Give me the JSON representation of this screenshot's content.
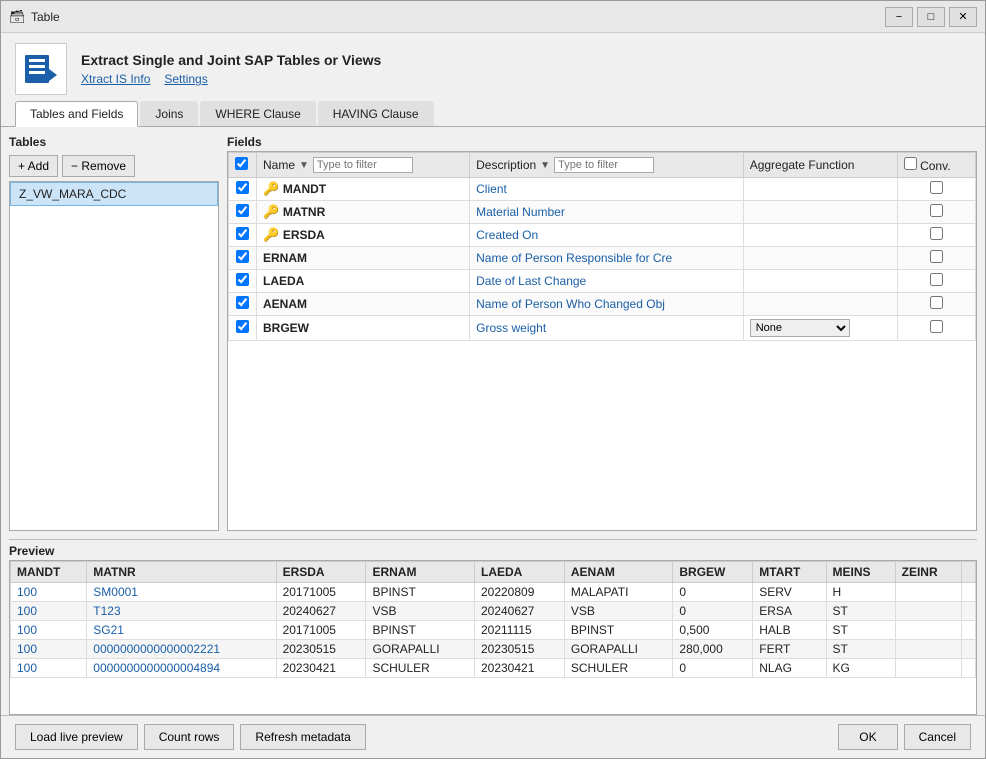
{
  "window": {
    "title": "Table",
    "controls": [
      "−",
      "□",
      "✕"
    ]
  },
  "header": {
    "title": "Extract Single and Joint SAP Tables or Views",
    "links": [
      "Xtract IS Info",
      "Settings"
    ]
  },
  "tabs": [
    {
      "label": "Tables and Fields",
      "active": true
    },
    {
      "label": "Joins",
      "active": false
    },
    {
      "label": "WHERE Clause",
      "active": false
    },
    {
      "label": "HAVING Clause",
      "active": false
    }
  ],
  "tables_panel": {
    "label": "Tables",
    "add_btn": "+ Add",
    "remove_btn": "− Remove",
    "items": [
      "Z_VW_MARA_CDC"
    ]
  },
  "fields_panel": {
    "label": "Fields",
    "columns": [
      {
        "key": "check",
        "label": ""
      },
      {
        "key": "name",
        "label": "Name"
      },
      {
        "key": "description",
        "label": "Description"
      },
      {
        "key": "aggregate",
        "label": "Aggregate Function"
      },
      {
        "key": "conv",
        "label": "Conv."
      }
    ],
    "name_filter_placeholder": "Type to filter",
    "desc_filter_placeholder": "Type to filter",
    "rows": [
      {
        "checked": true,
        "key": true,
        "name": "MANDT",
        "description": "Client",
        "aggregate": "",
        "conv": false
      },
      {
        "checked": true,
        "key": true,
        "name": "MATNR",
        "description": "Material Number",
        "aggregate": "",
        "conv": false
      },
      {
        "checked": true,
        "key": true,
        "name": "ERSDA",
        "description": "Created On",
        "aggregate": "",
        "conv": false
      },
      {
        "checked": true,
        "key": false,
        "name": "ERNAM",
        "description": "Name of Person Responsible for Cre",
        "aggregate": "",
        "conv": false
      },
      {
        "checked": true,
        "key": false,
        "name": "LAEDA",
        "description": "Date of Last Change",
        "aggregate": "",
        "conv": false
      },
      {
        "checked": true,
        "key": false,
        "name": "AENAM",
        "description": "Name of Person Who Changed Obj",
        "aggregate": "",
        "conv": false
      },
      {
        "checked": true,
        "key": false,
        "name": "BRGEW",
        "description": "Gross weight",
        "aggregate": "None",
        "conv": false
      }
    ]
  },
  "preview": {
    "label": "Preview",
    "columns": [
      "MANDT",
      "MATNR",
      "ERSDA",
      "ERNAM",
      "LAEDA",
      "AENAM",
      "BRGEW",
      "MTART",
      "MEINS",
      "ZEINR"
    ],
    "rows": [
      [
        "100",
        "SM0001",
        "20171005",
        "BPINST",
        "20220809",
        "MALAPATI",
        "0",
        "SERV",
        "H",
        ""
      ],
      [
        "100",
        "T123",
        "20240627",
        "VSB",
        "20240627",
        "VSB",
        "0",
        "ERSA",
        "ST",
        ""
      ],
      [
        "100",
        "SG21",
        "20171005",
        "BPINST",
        "20211115",
        "BPINST",
        "0,500",
        "HALB",
        "ST",
        ""
      ],
      [
        "100",
        "0000000000000002221",
        "20230515",
        "GORAPALLI",
        "20230515",
        "GORAPALLI",
        "280,000",
        "FERT",
        "ST",
        ""
      ],
      [
        "100",
        "0000000000000004894",
        "20230421",
        "SCHULER",
        "20230421",
        "SCHULER",
        "0",
        "NLAG",
        "KG",
        ""
      ]
    ],
    "link_cols": [
      0,
      1
    ]
  },
  "footer": {
    "load_preview_btn": "Load live preview",
    "count_rows_btn": "Count rows",
    "refresh_btn": "Refresh metadata",
    "ok_btn": "OK",
    "cancel_btn": "Cancel"
  }
}
